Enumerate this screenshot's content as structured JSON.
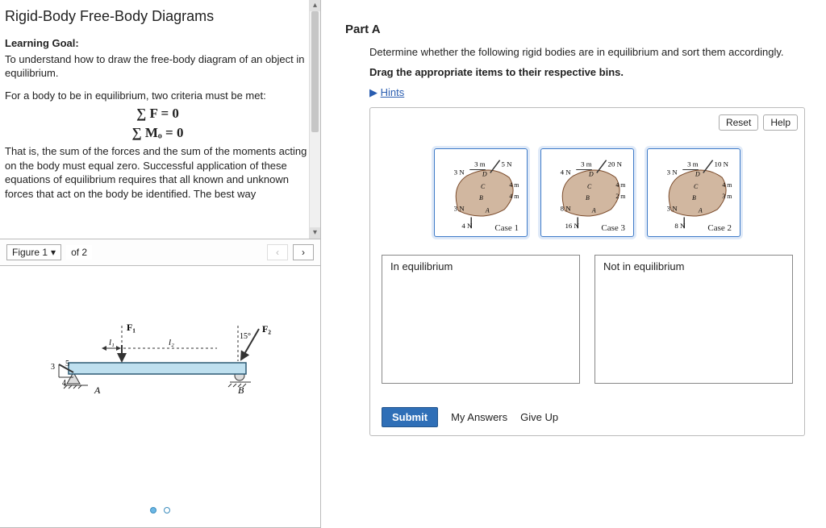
{
  "left": {
    "title": "Rigid-Body Free-Body Diagrams",
    "learning_goal_label": "Learning Goal:",
    "learning_goal": "To understand how to draw the free-body diagram of an object in equilibrium.",
    "criteria_intro": "For a body to be in equilibrium, two criteria must be met:",
    "eq1": "∑ F = 0",
    "eq2": "∑ Mₒ = 0",
    "explain": "That is, the sum of the forces and the sum of the moments acting on the body must equal zero. Successful application of these equations of equilibrium requires that all known and unknown forces that act on the body be identified. The best way",
    "figure_label": "Figure 1",
    "figure_of": "of 2",
    "nav_prev": "‹",
    "nav_next": "›",
    "beam": {
      "F1": "F₁",
      "F2": "F₂",
      "l1": "l₁",
      "l2": "l₂",
      "A": "A",
      "B": "B",
      "angle": "15°",
      "d3": "3",
      "d4": "4",
      "d5": "5"
    }
  },
  "right": {
    "part": "Part A",
    "prompt": "Determine whether the following rigid bodies are in equilibrium and sort them accordingly.",
    "instruction": "Drag the appropriate items to their respective bins.",
    "hints_label": "Hints",
    "reset": "Reset",
    "help": "Help",
    "items": [
      {
        "case": "Case 1",
        "top_left": "3 N",
        "top_right": "5 N",
        "top_d": "3 m",
        "dC": "4 m",
        "dB": "4 m",
        "left_mid": "3 N",
        "bottom": "4 N",
        "D": "D",
        "C": "C",
        "B": "B",
        "A": "A"
      },
      {
        "case": "Case 3",
        "top_left": "4 N",
        "top_right": "20 N",
        "top_d": "3 m",
        "dC": "4 m",
        "dB": "2 m",
        "left_mid": "8 N",
        "bottom": "16 N",
        "D": "D",
        "C": "C",
        "B": "B",
        "A": "A"
      },
      {
        "case": "Case 2",
        "top_left": "3 N",
        "top_right": "10 N",
        "top_d": "3 m",
        "dC": "4 m",
        "dB": "3 m",
        "left_mid": "3 N",
        "bottom": "8 N",
        "D": "D",
        "C": "C",
        "B": "B",
        "A": "A"
      }
    ],
    "bins": {
      "eq": "In equilibrium",
      "neq": "Not in equilibrium"
    },
    "actions": {
      "submit": "Submit",
      "my_answers": "My Answers",
      "give_up": "Give Up"
    }
  }
}
